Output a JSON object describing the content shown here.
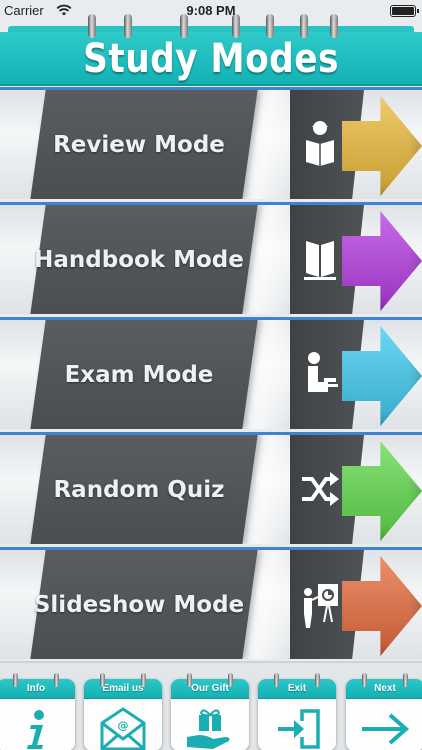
{
  "status_bar": {
    "carrier": "Carrier",
    "time": "9:08 PM",
    "battery_level": 1.0
  },
  "header": {
    "title": "Study Modes",
    "color": "#1bbcbd"
  },
  "modes": [
    {
      "label": "Review Mode",
      "icon": "reader-icon",
      "arrow_color": "#eab83a"
    },
    {
      "label": "Handbook Mode",
      "icon": "book-icon",
      "arrow_color": "#b43be0"
    },
    {
      "label": "Exam Mode",
      "icon": "student-desk-icon",
      "arrow_color": "#3ec9ee"
    },
    {
      "label": "Random Quiz",
      "icon": "shuffle-icon",
      "arrow_color": "#5fd84a"
    },
    {
      "label": "Slideshow Mode",
      "icon": "presenter-icon",
      "arrow_color": "#e56a3c"
    }
  ],
  "toolbar": {
    "items": [
      {
        "label": "Info",
        "icon": "info-icon"
      },
      {
        "label": "Email us",
        "icon": "email-envelope-icon"
      },
      {
        "label": "Our Gift",
        "icon": "gift-hand-icon"
      },
      {
        "label": "Exit",
        "icon": "exit-door-icon"
      },
      {
        "label": "Next",
        "icon": "arrow-right-icon"
      }
    ],
    "icon_color": "#1aaeb2"
  }
}
